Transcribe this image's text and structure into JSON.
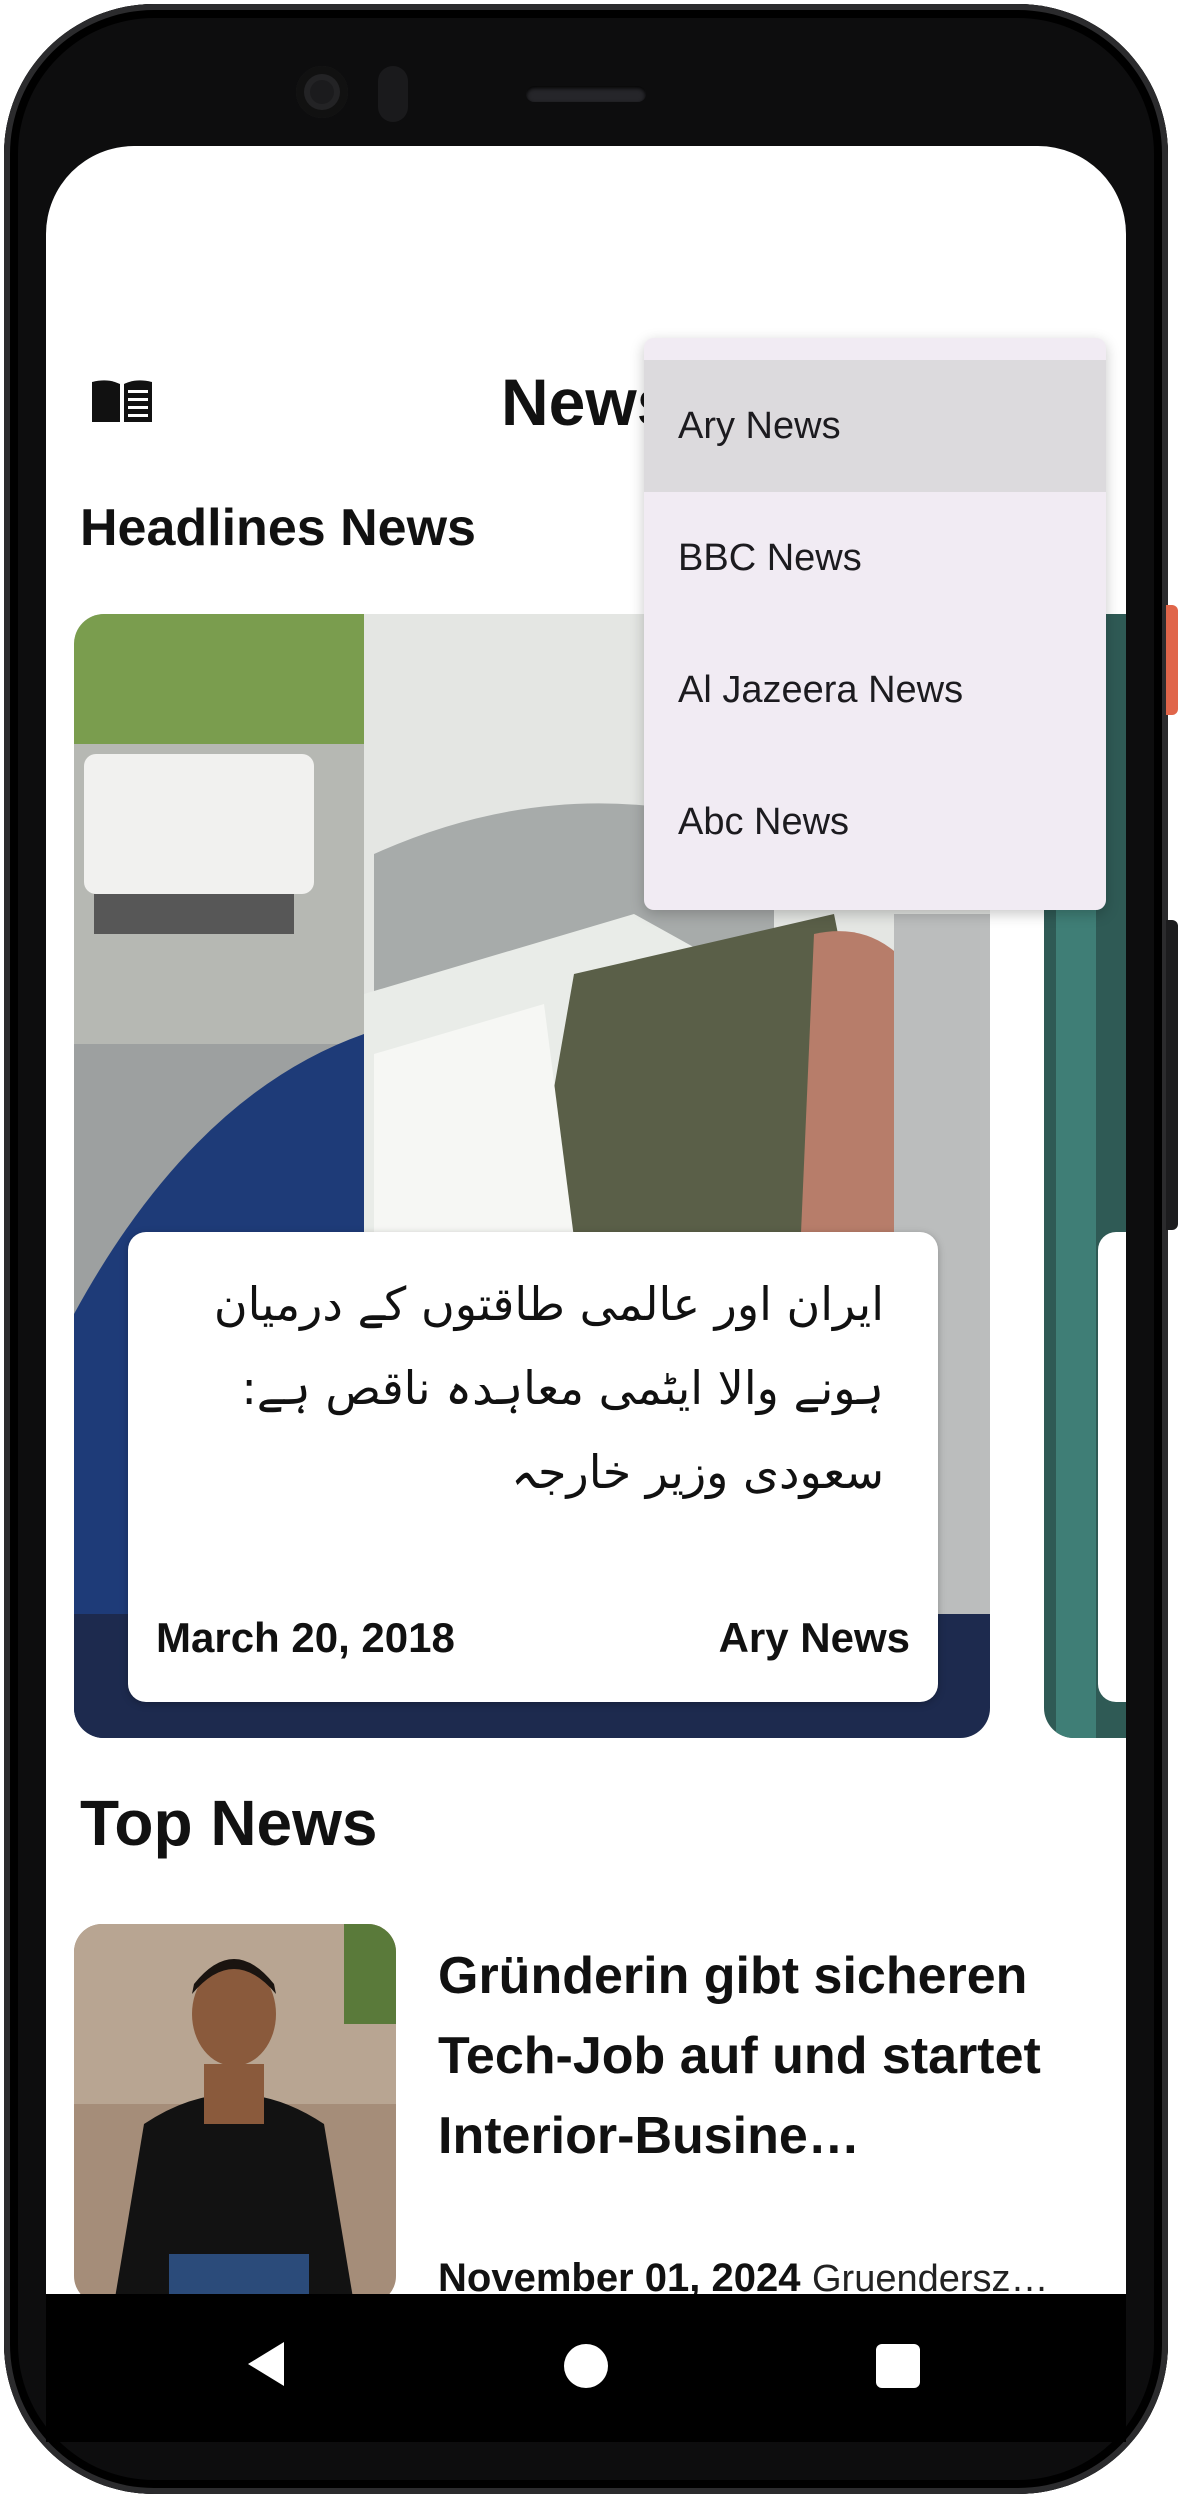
{
  "app": {
    "title": "News",
    "icon": "book-icon"
  },
  "headlines": {
    "section_title": "Headlines News",
    "cards": [
      {
        "title": "ایران اور عالمی طاقتوں کے درمیان ہونے والا ایٹمی معاہدہ ناقص ہے: سعودی وزیر خارجہ",
        "date": "March 20, 2018",
        "source": "Ary News"
      }
    ]
  },
  "top_news": {
    "section_title": "Top News",
    "items": [
      {
        "title": "Gründerin gibt sicheren Tech-Job auf und startet Interior-Busine…",
        "date": "November 01, 2024",
        "source": "Gruendersz…"
      }
    ]
  },
  "source_menu": {
    "selected": "Ary News",
    "options": [
      "Ary News",
      "BBC News",
      "Al Jazeera News",
      "Abc News"
    ]
  },
  "nav": {
    "back_icon": "back-triangle-icon",
    "home_icon": "home-circle-icon",
    "recents_icon": "recents-square-icon"
  }
}
